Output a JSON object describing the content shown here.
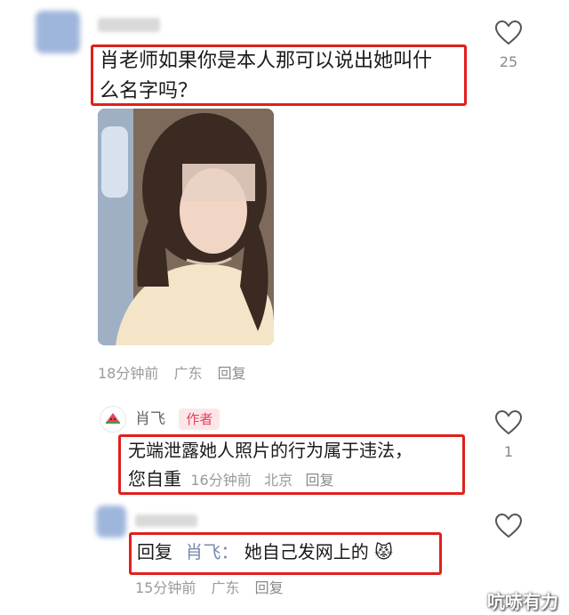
{
  "comment1": {
    "text_line1": "肖老师如果你是本人那可以说出她叫什",
    "text_line2": "么名字吗？",
    "likes": "25",
    "time": "18分钟前",
    "location": "广东",
    "reply": "回复"
  },
  "author_reply": {
    "name": "肖飞",
    "badge": "作者",
    "text_line1": "无端泄露她人照片的行为属于违法，",
    "text_line2": "您自重",
    "time": "16分钟前",
    "location": "北京",
    "reply": "回复",
    "likes": "1"
  },
  "comment3": {
    "prefix": "回复",
    "reply_to": "肖飞：",
    "text": "她自己发网上的",
    "emoji": "😾",
    "time": "15分钟前",
    "location": "广东",
    "reply": "回复"
  },
  "watermark": "吭哧有力",
  "colors": {
    "highlight": "#e0201c",
    "author_badge_bg": "#fde6ea",
    "author_badge_fg": "#e0435a"
  }
}
